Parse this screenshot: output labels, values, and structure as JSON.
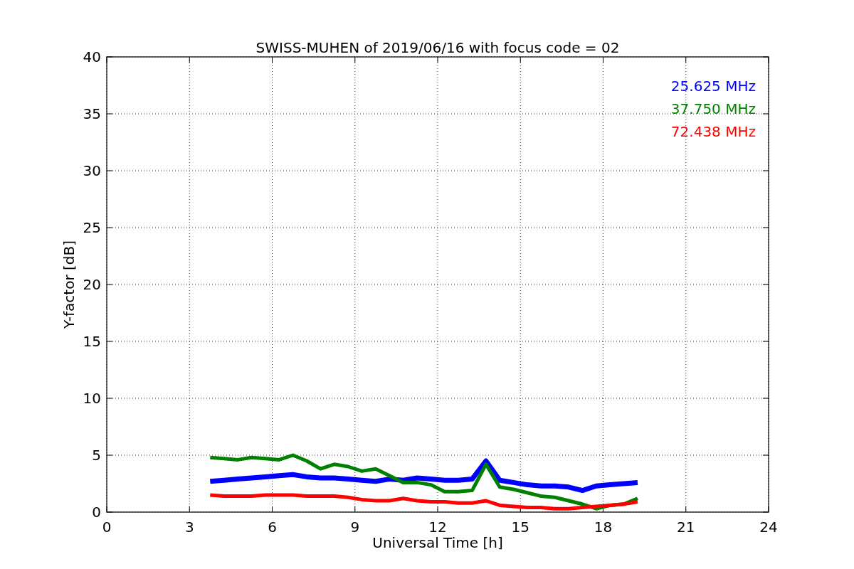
{
  "chart_data": {
    "type": "line",
    "title": "SWISS-MUHEN of 2019/06/16 with focus code = 02",
    "xlabel": "Universal Time [h]",
    "ylabel": "Y-factor [dB]",
    "x": [
      3.75,
      4.25,
      4.75,
      5.25,
      5.75,
      6.25,
      6.75,
      7.25,
      7.75,
      8.25,
      8.75,
      9.25,
      9.75,
      10.25,
      10.75,
      11.25,
      11.75,
      12.25,
      12.75,
      13.25,
      13.75,
      14.25,
      14.75,
      15.25,
      15.75,
      16.25,
      16.75,
      17.25,
      17.75,
      18.25,
      18.75,
      19.25
    ],
    "series": [
      {
        "name": "25.625 MHz",
        "color": "#0000ff",
        "values": [
          2.7,
          2.8,
          2.9,
          3.0,
          3.1,
          3.2,
          3.3,
          3.1,
          3.0,
          3.0,
          2.9,
          2.8,
          2.7,
          2.9,
          2.8,
          3.0,
          2.9,
          2.8,
          2.8,
          2.9,
          4.5,
          2.8,
          2.6,
          2.4,
          2.3,
          2.3,
          2.2,
          1.9,
          2.3,
          2.4,
          2.5,
          2.6
        ]
      },
      {
        "name": "37.750 MHz",
        "color": "#008000",
        "values": [
          4.8,
          4.7,
          4.6,
          4.8,
          4.7,
          4.6,
          5.0,
          4.5,
          3.8,
          4.2,
          4.0,
          3.6,
          3.8,
          3.2,
          2.6,
          2.6,
          2.4,
          1.8,
          1.8,
          1.9,
          4.2,
          2.2,
          2.0,
          1.7,
          1.4,
          1.3,
          1.0,
          0.7,
          0.3,
          0.6,
          0.7,
          1.2
        ]
      },
      {
        "name": "72.438 MHz",
        "color": "#ff0000",
        "values": [
          1.5,
          1.4,
          1.4,
          1.4,
          1.5,
          1.5,
          1.5,
          1.4,
          1.4,
          1.4,
          1.3,
          1.1,
          1.0,
          1.0,
          1.2,
          1.0,
          0.9,
          0.9,
          0.8,
          0.8,
          1.0,
          0.6,
          0.5,
          0.4,
          0.4,
          0.3,
          0.3,
          0.4,
          0.5,
          0.6,
          0.7,
          0.9
        ]
      }
    ],
    "xlim": [
      0,
      24
    ],
    "ylim": [
      0,
      40
    ],
    "xticks": [
      0,
      3,
      6,
      9,
      12,
      15,
      18,
      21,
      24
    ],
    "yticks": [
      0,
      5,
      10,
      15,
      20,
      25,
      30,
      35,
      40
    ],
    "grid": true
  }
}
